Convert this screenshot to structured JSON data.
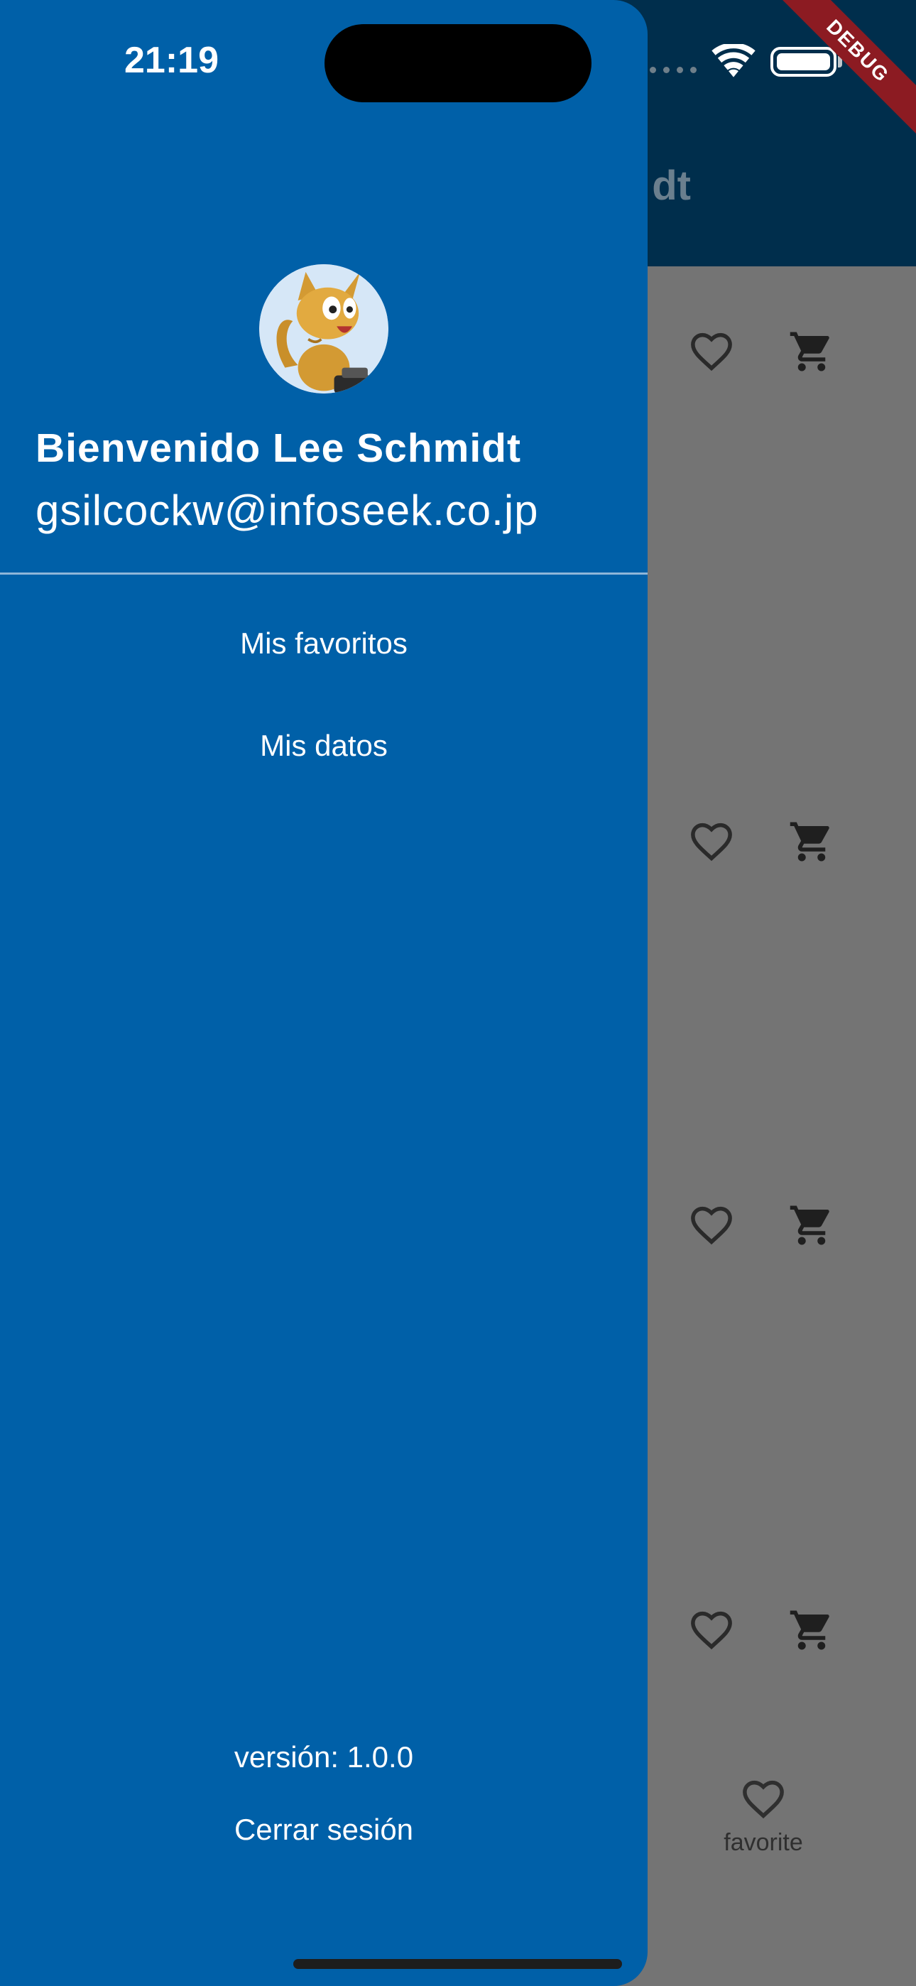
{
  "status_bar": {
    "time": "21:19"
  },
  "debug_banner": "DEBUG",
  "background_app": {
    "title_fragment": "dt",
    "row_icons": [
      "heart-outline-icon",
      "cart-icon"
    ],
    "bottom_nav": {
      "label": "favorite",
      "icon": "heart-outline-icon"
    }
  },
  "drawer": {
    "welcome": "Bienvenido Lee Schmidt",
    "email": "gsilcockw@infoseek.co.jp",
    "menu": [
      {
        "label": "Mis favoritos"
      },
      {
        "label": "Mis datos"
      }
    ],
    "version": "versión: 1.0.0",
    "logout": "Cerrar sesión"
  },
  "colors": {
    "drawer": "#0060a8",
    "app_bar": "#002e4c",
    "scrim": "#747474",
    "debug": "#8c1b22"
  }
}
